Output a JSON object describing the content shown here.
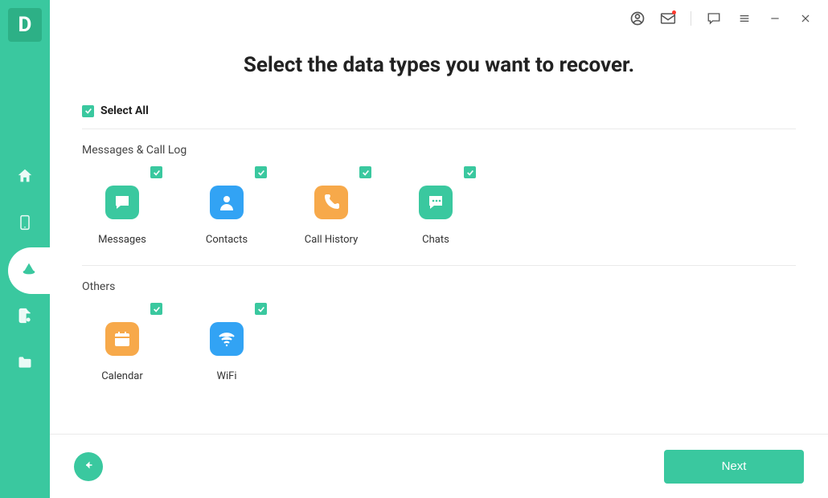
{
  "app": {
    "logo_letter": "D"
  },
  "page": {
    "title": "Select the data types you want to recover.",
    "select_all_label": "Select All"
  },
  "sections": {
    "messages_log": {
      "title": "Messages & Call Log",
      "items": {
        "messages": {
          "label": "Messages"
        },
        "contacts": {
          "label": "Contacts"
        },
        "call_history": {
          "label": "Call History"
        },
        "chats": {
          "label": "Chats"
        }
      }
    },
    "others": {
      "title": "Others",
      "items": {
        "calendar": {
          "label": "Calendar"
        },
        "wifi": {
          "label": "WiFi"
        }
      }
    }
  },
  "footer": {
    "next_label": "Next"
  },
  "colors": {
    "accent": "#3ac89f",
    "blue": "#32a3f4",
    "orange": "#f7a94a"
  }
}
